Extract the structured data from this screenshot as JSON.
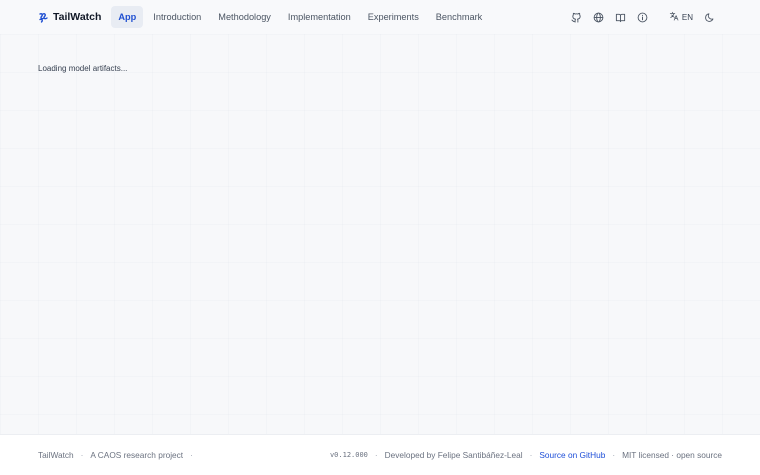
{
  "header": {
    "brand": "TailWatch",
    "nav": [
      {
        "label": "App",
        "active": true
      },
      {
        "label": "Introduction"
      },
      {
        "label": "Methodology"
      },
      {
        "label": "Implementation"
      },
      {
        "label": "Experiments"
      },
      {
        "label": "Benchmark"
      }
    ],
    "tools": [
      "github-icon",
      "globe-icon",
      "book-icon",
      "info-icon"
    ],
    "language": "EN",
    "theme_icon": "moon-icon"
  },
  "main": {
    "status": "Loading model artifacts..."
  },
  "footer": {
    "brand": "TailWatch",
    "tagline": "A CAOS research project",
    "version": "v0.12.000",
    "developer": "Developed by Felipe Santibáñez-Leal",
    "source": "Source on GitHub",
    "license": "MIT licensed · open source"
  },
  "colors": {
    "accent": "#1f4fd1",
    "background": "#f7f8fa",
    "footer_bg": "#ffffff"
  }
}
